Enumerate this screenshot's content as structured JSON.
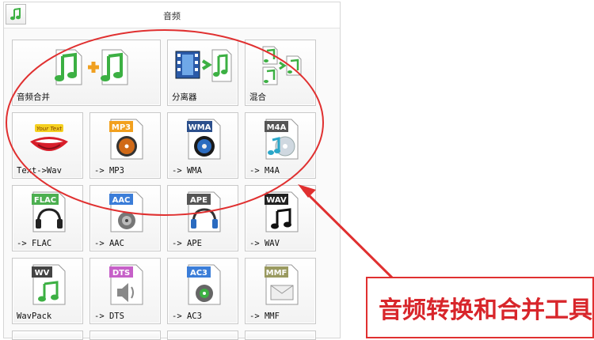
{
  "window": {
    "title": "音频"
  },
  "tiles": [
    {
      "label": "音频合并",
      "icon": "audio-merge-icon"
    },
    {
      "label": "分离器",
      "icon": "video-splitter-icon"
    },
    {
      "label": "混合",
      "icon": "audio-mix-icon"
    },
    {
      "label": "Text->Wav",
      "icon": "text-to-speech-mouth-icon",
      "badge": "Your Text"
    },
    {
      "label": "-> MP3",
      "icon": "mp3-file-icon",
      "badge": "MP3"
    },
    {
      "label": "-> WMA",
      "icon": "wma-file-icon",
      "badge": "WMA"
    },
    {
      "label": "-> M4A",
      "icon": "m4a-file-icon",
      "badge": "M4A"
    },
    {
      "label": "-> FLAC",
      "icon": "flac-file-icon",
      "badge": "FLAC"
    },
    {
      "label": "-> AAC",
      "icon": "aac-file-icon",
      "badge": "AAC"
    },
    {
      "label": "-> APE",
      "icon": "ape-file-icon",
      "badge": "APE"
    },
    {
      "label": "-> WAV",
      "icon": "wav-file-icon",
      "badge": "WAV"
    },
    {
      "label": "WavPack",
      "icon": "wavpack-file-icon",
      "badge": "WV"
    },
    {
      "label": "-> DTS",
      "icon": "dts-file-icon",
      "badge": "DTS"
    },
    {
      "label": "-> AC3",
      "icon": "ac3-file-icon",
      "badge": "AC3"
    },
    {
      "label": "-> MMF",
      "icon": "mmf-file-icon",
      "badge": "MMF"
    }
  ],
  "annotation": {
    "callout_text": "音频转换和合并工具"
  },
  "colors": {
    "annotation_red": "#e03030",
    "note_green": "#3cb043"
  }
}
